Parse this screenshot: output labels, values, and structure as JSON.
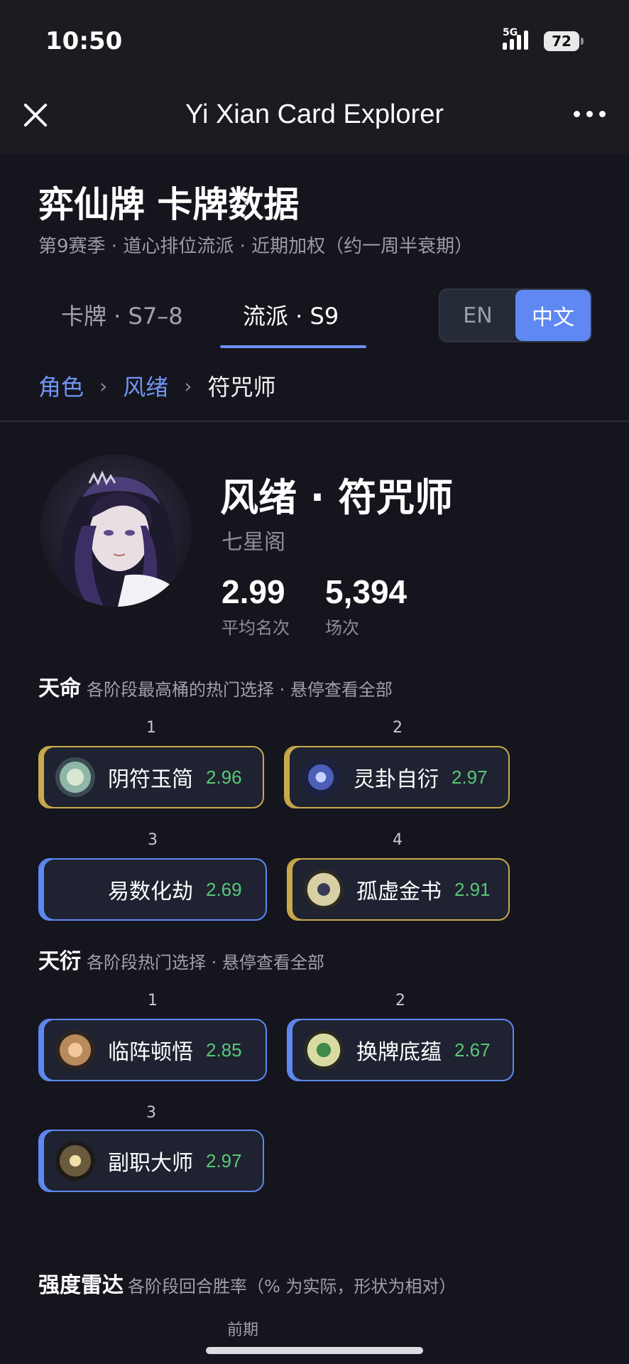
{
  "status": {
    "time": "10:50",
    "network": "5G",
    "battery": "72"
  },
  "appbar": {
    "title": "Yi Xian Card Explorer"
  },
  "header": {
    "title": "弈仙牌 卡牌数据",
    "subtitle": "第9赛季 · 道心排位流派 · 近期加权（约一周半衰期）"
  },
  "tabs": [
    {
      "label": "卡牌 · S7–8",
      "active": false
    },
    {
      "label": "流派 · S9",
      "active": true
    }
  ],
  "lang": {
    "en": "EN",
    "zh": "中文",
    "selected": "中文"
  },
  "breadcrumb": {
    "root": "角色",
    "parent": "风绪",
    "current": "符咒师",
    "sep": "›"
  },
  "hero": {
    "name": "风绪 · 符咒师",
    "sect": "七星阁",
    "avg_rank": "2.99",
    "avg_rank_label": "平均名次",
    "matches": "5,394",
    "matches_label": "场次"
  },
  "destiny": {
    "title": "天命",
    "hint": "各阶段最高桶的热门选择 · 悬停查看全部",
    "items": [
      {
        "rank": "1",
        "name": "阴符玉简",
        "score": "2.96",
        "icon": "jade-slip-icon"
      },
      {
        "rank": "2",
        "name": "灵卦自衍",
        "score": "2.97",
        "icon": "spirit-trigram-icon"
      },
      {
        "rank": "3",
        "name": "易数化劫",
        "score": "2.69",
        "icon": ""
      },
      {
        "rank": "4",
        "name": "孤虚金书",
        "score": "2.91",
        "icon": "golden-book-icon"
      }
    ]
  },
  "talent": {
    "title": "天衍",
    "hint": "各阶段热门选择 · 悬停查看全部",
    "items": [
      {
        "rank": "1",
        "name": "临阵顿悟",
        "score": "2.85",
        "icon": "meditation-icon"
      },
      {
        "rank": "2",
        "name": "换牌底蕴",
        "score": "2.67",
        "icon": "card-swap-icon"
      },
      {
        "rank": "3",
        "name": "副职大师",
        "score": "2.97",
        "icon": "side-job-master-icon"
      }
    ]
  },
  "radar": {
    "title": "强度雷达",
    "hint": "各阶段回合胜率（% 为实际，形状为相对）",
    "axis_top": "前期"
  },
  "colors": {
    "accent": "#5f88f2",
    "gold": "#c9a94b",
    "score_green": "#58c878"
  }
}
